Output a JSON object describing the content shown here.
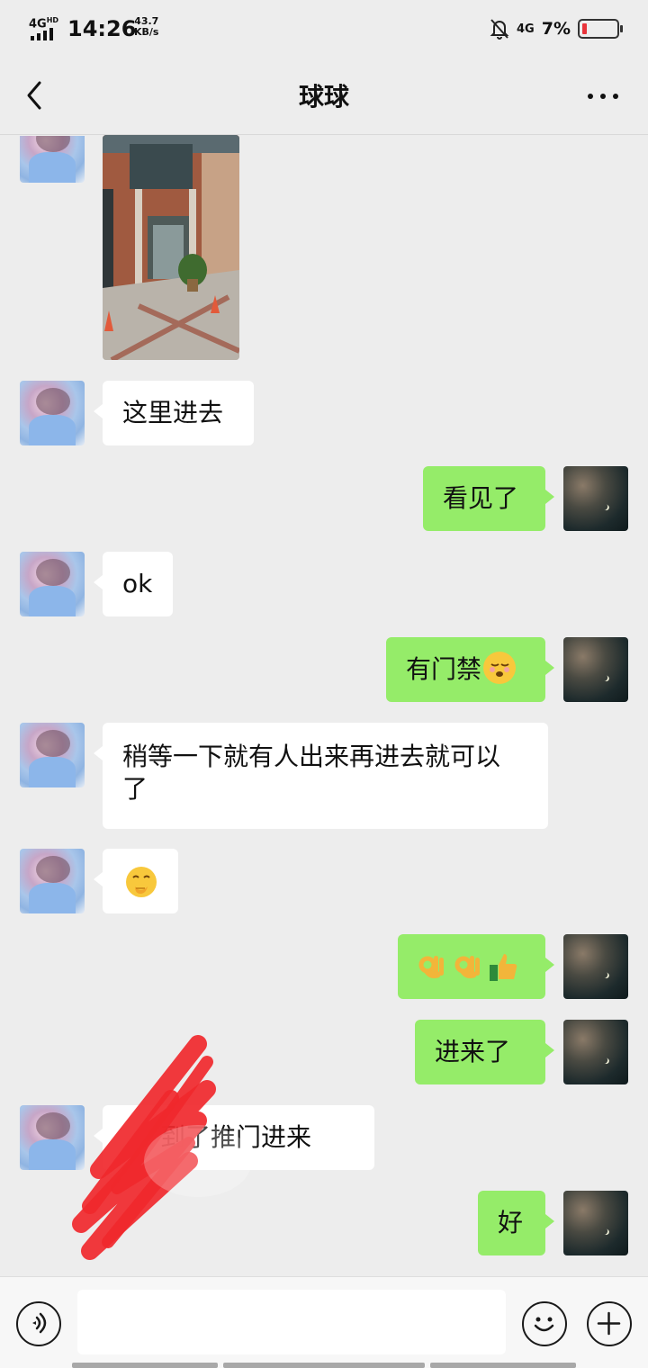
{
  "status_bar": {
    "network": "4G",
    "network_hd": "HD",
    "time": "14:26",
    "speed_value": "43.7",
    "speed_unit": "KB/s",
    "mobile": "4G",
    "battery": "7%",
    "battery_level": 0.07,
    "icons": [
      "signal-icon",
      "mute-bell-icon",
      "battery-icon"
    ]
  },
  "header": {
    "title": "球球",
    "icons": [
      "back-icon",
      "more-icon"
    ]
  },
  "messages": [
    {
      "side": "in",
      "kind": "image",
      "image_desc": "building-entrance-photo"
    },
    {
      "side": "in",
      "text": "这里进去"
    },
    {
      "side": "out",
      "text": "看见了"
    },
    {
      "side": "in",
      "text": "ok"
    },
    {
      "side": "out",
      "text": "有门禁",
      "emoji": "hushed-face-emoji"
    },
    {
      "side": "in",
      "text_line1": "稍等一下就有人出来再进去就可以",
      "text_line2": "了"
    },
    {
      "side": "in",
      "emoji": "face-with-hand-over-mouth-emoji"
    },
    {
      "side": "out",
      "emoji": [
        "ok-hand-emoji",
        "ok-hand-emoji",
        "thumbs-up-emoji"
      ]
    },
    {
      "side": "out",
      "text": "进来了"
    },
    {
      "side": "in",
      "text": "到了推门进来"
    },
    {
      "side": "out",
      "text": "好"
    }
  ],
  "colors": {
    "background": "#ededed",
    "outgoing_bubble": "#95ec69",
    "incoming_bubble": "#ffffff",
    "scribble": "#f0282d",
    "battery_low": "#e8343b"
  },
  "input_bar": {
    "placeholder": "",
    "icons": [
      "voice-icon",
      "emoji-icon",
      "plus-icon"
    ]
  }
}
